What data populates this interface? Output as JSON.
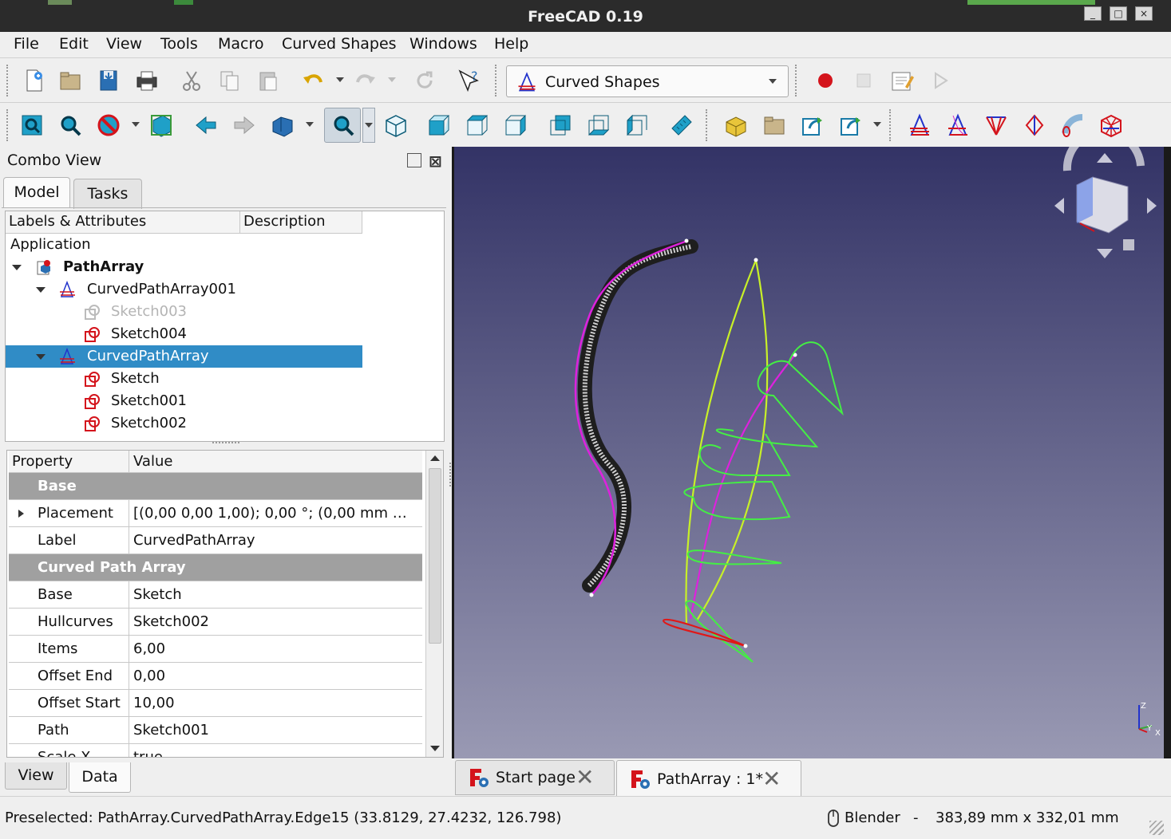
{
  "window": {
    "title": "FreeCAD 0.19"
  },
  "menu": [
    "File",
    "Edit",
    "View",
    "Tools",
    "Macro",
    "Curved Shapes",
    "Windows",
    "Help"
  ],
  "workbench": {
    "selected": "Curved Shapes"
  },
  "combo_view": {
    "title": "Combo View",
    "tabs": [
      "Model",
      "Tasks"
    ],
    "tree_headers": [
      "Labels & Attributes",
      "Description"
    ],
    "tree": [
      {
        "label": "Application",
        "level": 0
      },
      {
        "label": "PathArray",
        "level": 1,
        "bold": true
      },
      {
        "label": "CurvedPathArray001",
        "level": 2
      },
      {
        "label": "Sketch003",
        "level": 3,
        "disabled": true
      },
      {
        "label": "Sketch004",
        "level": 3
      },
      {
        "label": "CurvedPathArray",
        "level": 2,
        "selected": true
      },
      {
        "label": "Sketch",
        "level": 3
      },
      {
        "label": "Sketch001",
        "level": 3
      },
      {
        "label": "Sketch002",
        "level": 3
      }
    ],
    "prop_headers": [
      "Property",
      "Value"
    ],
    "properties": [
      {
        "group": "Base"
      },
      {
        "name": "Placement",
        "value": "[(0,00 0,00 1,00); 0,00 °; (0,00 mm  …"
      },
      {
        "name": "Label",
        "value": "CurvedPathArray"
      },
      {
        "group": "Curved Path Array"
      },
      {
        "name": "Base",
        "value": "Sketch"
      },
      {
        "name": "Hullcurves",
        "value": "Sketch002"
      },
      {
        "name": "Items",
        "value": "6,00"
      },
      {
        "name": "Offset End",
        "value": "0,00"
      },
      {
        "name": "Offset Start",
        "value": "10,00"
      },
      {
        "name": "Path",
        "value": "Sketch001"
      },
      {
        "name": "Scale X",
        "value": "true"
      }
    ],
    "bottom_tabs": [
      "View",
      "Data"
    ]
  },
  "doc_tabs": [
    "Start page",
    "PathArray : 1*"
  ],
  "status": {
    "text": "Preselected: PathArray.CurvedPathArray.Edge15 (33.8129, 27.4232, 126.798)",
    "nav_style": "Blender",
    "separator": "-",
    "dimensions": "383,89 mm x 332,01 mm"
  },
  "colors": {
    "selection": "#308cc6",
    "viewport_top": "#333366",
    "viewport_bottom": "#9999b3",
    "accent_red": "#d4141c"
  },
  "icons": [
    "new-file-icon",
    "open-icon",
    "save-icon",
    "print-icon",
    "cut-icon",
    "copy-icon",
    "paste-icon",
    "undo-icon",
    "redo-icon",
    "refresh-icon",
    "whats-this-icon",
    "record-macro-icon",
    "stop-macro-icon",
    "edit-macro-icon",
    "run-macro-icon",
    "fit-all-icon",
    "fit-selection-icon",
    "draw-style-icon",
    "bounding-box-icon",
    "back-icon",
    "forward-icon",
    "sync-view-icon",
    "isometric-icon",
    "front-view-icon",
    "top-view-icon",
    "right-view-icon",
    "rear-view-icon",
    "bottom-view-icon",
    "left-view-icon",
    "measure-icon",
    "part-icon",
    "group-icon",
    "link-icon",
    "link-actions-icon",
    "curved-array-icon",
    "curved-path-array-icon",
    "curved-segment-icon",
    "interpolated-middle-icon",
    "surface-cut-icon",
    "named-sketcher-icon"
  ]
}
